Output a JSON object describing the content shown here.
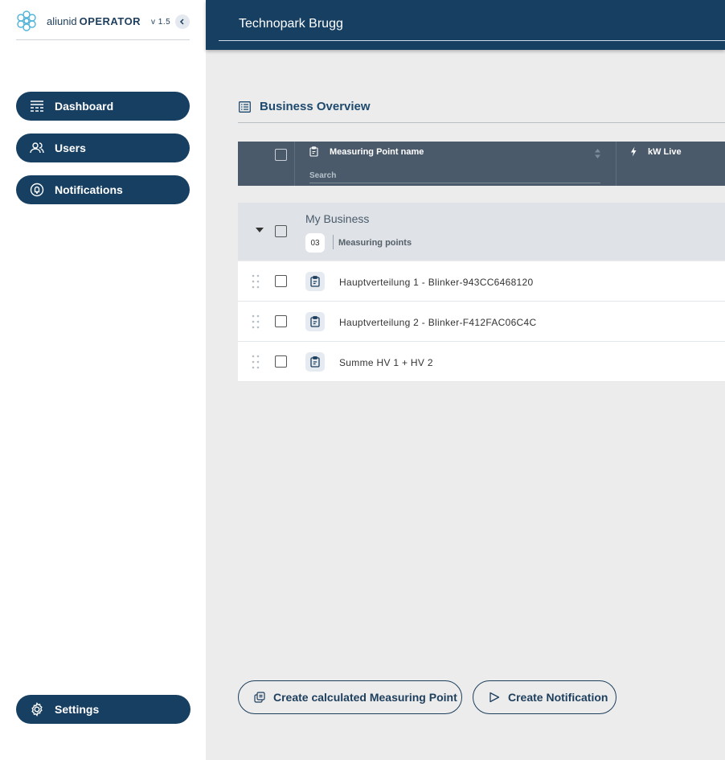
{
  "sidebar": {
    "brand_name": "aliunid",
    "brand_product": "OPERATOR",
    "version": "v 1.5",
    "items": [
      {
        "label": "Dashboard",
        "icon": "dashboard-icon"
      },
      {
        "label": "Users",
        "icon": "users-icon"
      },
      {
        "label": "Notifications",
        "icon": "notifications-icon"
      }
    ],
    "settings_label": "Settings"
  },
  "header": {
    "title": "Technopark Brugg"
  },
  "section": {
    "title": "Business Overview"
  },
  "table": {
    "columns": [
      {
        "label": "Measuring Point name",
        "icon": "clipboard-icon"
      },
      {
        "label": "kW Live",
        "icon": "lightning-icon"
      }
    ],
    "search_placeholder": "Search",
    "group": {
      "name": "My Business",
      "count": "03",
      "count_label": "Measuring points"
    },
    "rows": [
      {
        "name": "Hauptverteilung 1 - Blinker-943CC6468120"
      },
      {
        "name": "Hauptverteilung 2 - Blinker-F412FAC06C4C"
      },
      {
        "name": "Summe HV 1 + HV 2"
      }
    ]
  },
  "actions": {
    "create_calculated": "Create calculated Measuring Point",
    "create_notification": "Create Notification"
  },
  "colors": {
    "primary": "#173f62",
    "table_header": "#4a5a6b",
    "group_row": "#dfe3e8",
    "background": "#ececec"
  }
}
